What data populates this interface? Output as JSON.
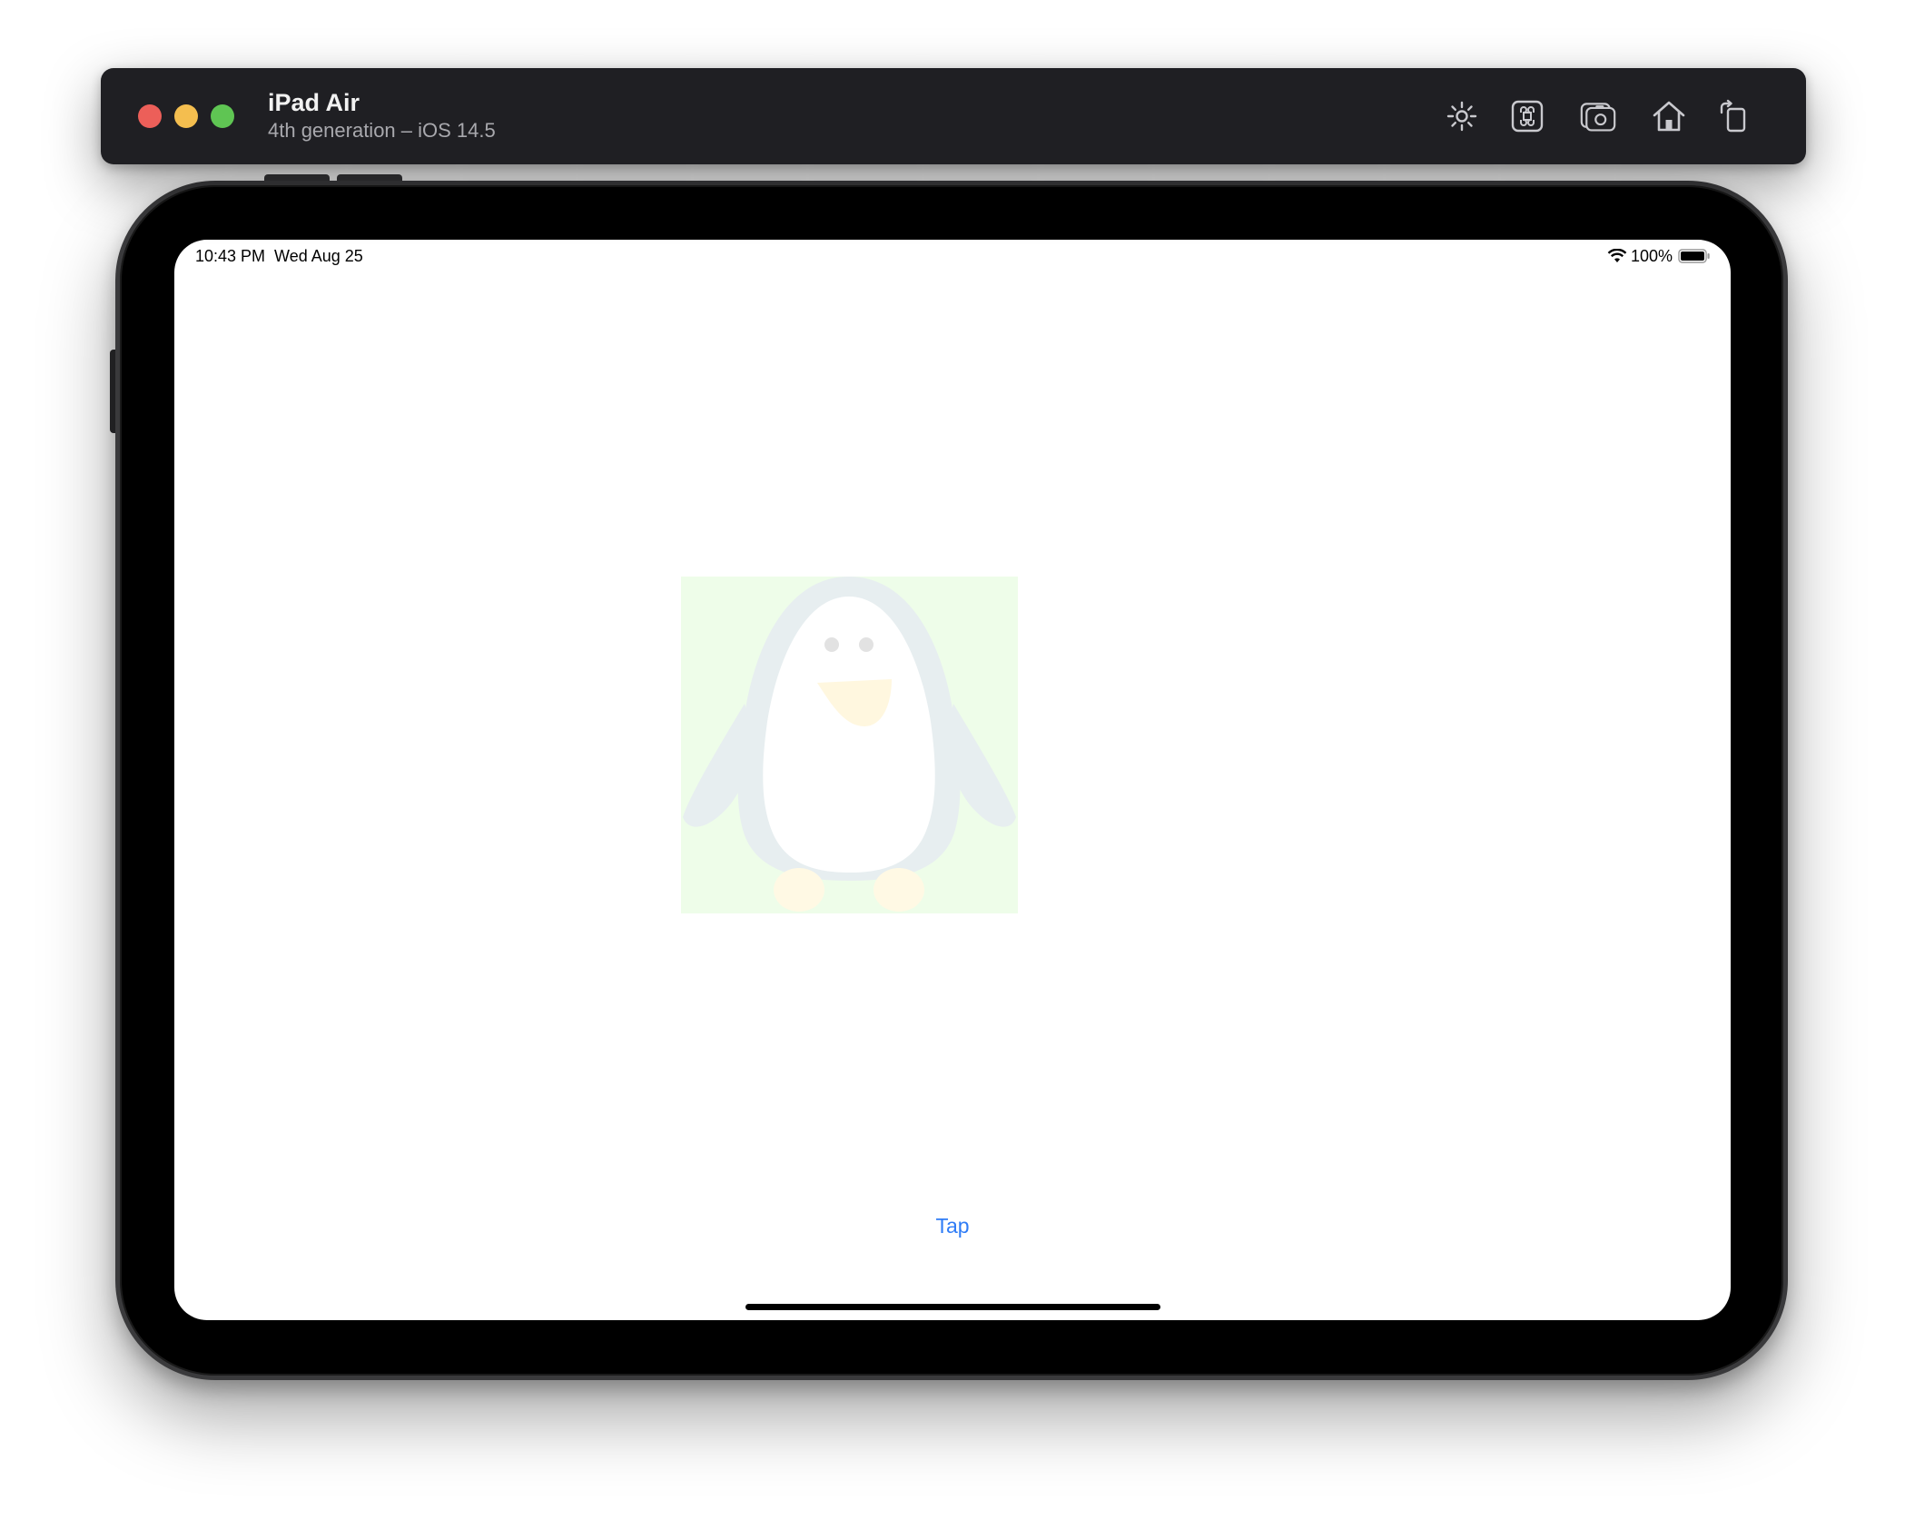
{
  "window": {
    "device_name": "iPad Air",
    "device_subtitle": "4th generation – iOS 14.5",
    "traffic_lights": {
      "close_color": "#ec5f59",
      "minimize_color": "#f4be4f",
      "zoom_color": "#5fc553"
    },
    "toolbar": [
      {
        "name": "brightness-icon"
      },
      {
        "name": "command-icon"
      },
      {
        "name": "screenshot-camera-icon"
      },
      {
        "name": "home-icon"
      },
      {
        "name": "rotate-icon"
      }
    ]
  },
  "status_bar": {
    "time": "10:43 PM",
    "date": "Wed Aug 25",
    "wifi_icon": "wifi-icon",
    "battery_percent": "100%",
    "battery_icon": "battery-full-icon"
  },
  "content": {
    "image": {
      "name": "penguin-image",
      "background_color": "#eefde9"
    },
    "tap_button_label": "Tap",
    "accent_color": "#2f7cf6"
  }
}
